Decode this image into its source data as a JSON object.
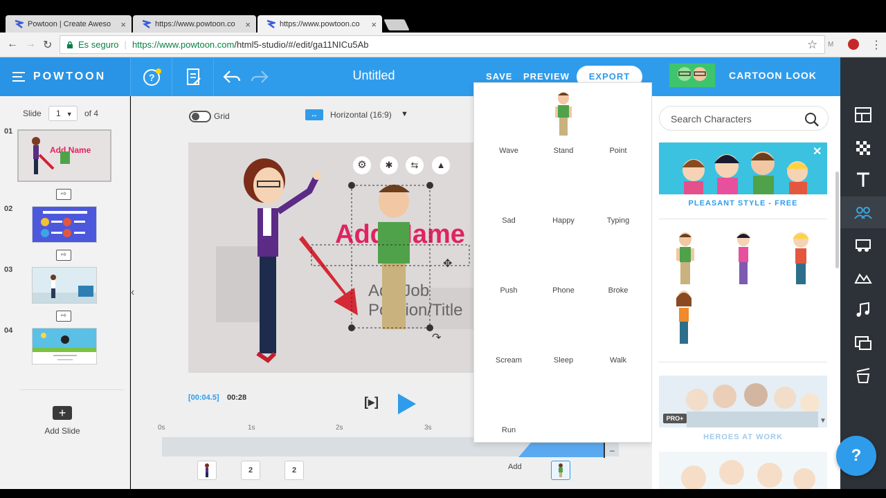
{
  "browser": {
    "tabs": [
      {
        "title": "Powtoon | Create Aweso",
        "close": "×"
      },
      {
        "title": "https://www.powtoon.co",
        "close": "×"
      },
      {
        "title": "https://www.powtoon.co",
        "close": "×"
      }
    ],
    "secure_label": "Es seguro",
    "url_host": "https://www.powtoon.com",
    "url_path": "/html5-studio/#/edit/ga11NICu5Ab"
  },
  "header": {
    "brand": "POWTOON",
    "doc_title": "Untitled",
    "save_label": "SAVE",
    "preview_label": "PREVIEW",
    "export_label": "EXPORT"
  },
  "slides_panel": {
    "slide_label": "Slide",
    "current": "1",
    "of_label": "of 4",
    "slides": [
      {
        "num": "01"
      },
      {
        "num": "02"
      },
      {
        "num": "03"
      },
      {
        "num": "04"
      }
    ],
    "add_slide_label": "Add Slide"
  },
  "canvas": {
    "grid_label": "Grid",
    "orientation_label": "Horizontal (16:9)",
    "stage_text": {
      "name": "Add Name",
      "sub": "Add Job",
      "sub2": "Position/Title"
    }
  },
  "timeline": {
    "current_time": "[00:04.5]",
    "total_time": "00:28",
    "ticks": [
      "0s",
      "1s",
      "2s",
      "3s"
    ],
    "markers": [
      "2",
      "2"
    ],
    "add_label": "Add"
  },
  "actions_popup": {
    "items": [
      "Wave",
      "Stand",
      "Point",
      "Sad",
      "Happy",
      "Typing",
      "Push",
      "Phone",
      "Broke",
      "Scream",
      "Sleep",
      "Walk",
      "Run"
    ]
  },
  "right_panel": {
    "look_label": "CARTOON LOOK",
    "search_placeholder": "Search Characters",
    "style1_label": "PLEASANT STYLE - FREE",
    "style2_label": "HEROES AT WORK",
    "pro_badge": "PRO+"
  },
  "rail_icons": [
    "layout-icon",
    "background-icon",
    "text-icon",
    "characters-icon",
    "props-icon",
    "markers-icon",
    "music-icon",
    "media-icon",
    "specials-icon"
  ],
  "help_label": "?",
  "colors": {
    "accent": "#2f9ceb",
    "rail": "#2d3238",
    "green": "#0b8043"
  }
}
